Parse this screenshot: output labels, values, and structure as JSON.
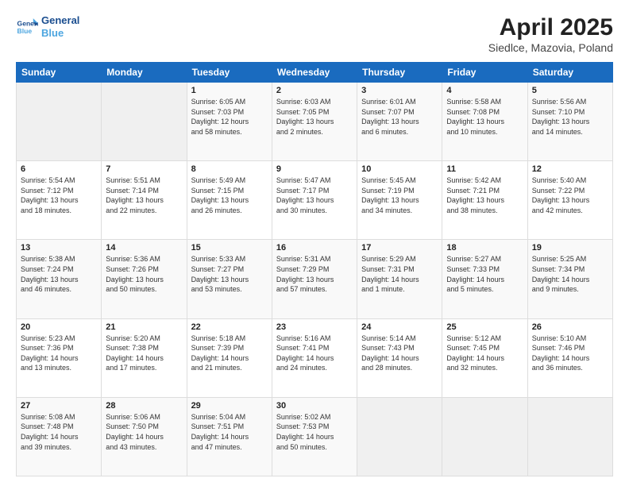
{
  "logo": {
    "line1": "General",
    "line2": "Blue"
  },
  "title": "April 2025",
  "subtitle": "Siedlce, Mazovia, Poland",
  "headers": [
    "Sunday",
    "Monday",
    "Tuesday",
    "Wednesday",
    "Thursday",
    "Friday",
    "Saturday"
  ],
  "weeks": [
    [
      {
        "num": "",
        "info": ""
      },
      {
        "num": "",
        "info": ""
      },
      {
        "num": "1",
        "info": "Sunrise: 6:05 AM\nSunset: 7:03 PM\nDaylight: 12 hours\nand 58 minutes."
      },
      {
        "num": "2",
        "info": "Sunrise: 6:03 AM\nSunset: 7:05 PM\nDaylight: 13 hours\nand 2 minutes."
      },
      {
        "num": "3",
        "info": "Sunrise: 6:01 AM\nSunset: 7:07 PM\nDaylight: 13 hours\nand 6 minutes."
      },
      {
        "num": "4",
        "info": "Sunrise: 5:58 AM\nSunset: 7:08 PM\nDaylight: 13 hours\nand 10 minutes."
      },
      {
        "num": "5",
        "info": "Sunrise: 5:56 AM\nSunset: 7:10 PM\nDaylight: 13 hours\nand 14 minutes."
      }
    ],
    [
      {
        "num": "6",
        "info": "Sunrise: 5:54 AM\nSunset: 7:12 PM\nDaylight: 13 hours\nand 18 minutes."
      },
      {
        "num": "7",
        "info": "Sunrise: 5:51 AM\nSunset: 7:14 PM\nDaylight: 13 hours\nand 22 minutes."
      },
      {
        "num": "8",
        "info": "Sunrise: 5:49 AM\nSunset: 7:15 PM\nDaylight: 13 hours\nand 26 minutes."
      },
      {
        "num": "9",
        "info": "Sunrise: 5:47 AM\nSunset: 7:17 PM\nDaylight: 13 hours\nand 30 minutes."
      },
      {
        "num": "10",
        "info": "Sunrise: 5:45 AM\nSunset: 7:19 PM\nDaylight: 13 hours\nand 34 minutes."
      },
      {
        "num": "11",
        "info": "Sunrise: 5:42 AM\nSunset: 7:21 PM\nDaylight: 13 hours\nand 38 minutes."
      },
      {
        "num": "12",
        "info": "Sunrise: 5:40 AM\nSunset: 7:22 PM\nDaylight: 13 hours\nand 42 minutes."
      }
    ],
    [
      {
        "num": "13",
        "info": "Sunrise: 5:38 AM\nSunset: 7:24 PM\nDaylight: 13 hours\nand 46 minutes."
      },
      {
        "num": "14",
        "info": "Sunrise: 5:36 AM\nSunset: 7:26 PM\nDaylight: 13 hours\nand 50 minutes."
      },
      {
        "num": "15",
        "info": "Sunrise: 5:33 AM\nSunset: 7:27 PM\nDaylight: 13 hours\nand 53 minutes."
      },
      {
        "num": "16",
        "info": "Sunrise: 5:31 AM\nSunset: 7:29 PM\nDaylight: 13 hours\nand 57 minutes."
      },
      {
        "num": "17",
        "info": "Sunrise: 5:29 AM\nSunset: 7:31 PM\nDaylight: 14 hours\nand 1 minute."
      },
      {
        "num": "18",
        "info": "Sunrise: 5:27 AM\nSunset: 7:33 PM\nDaylight: 14 hours\nand 5 minutes."
      },
      {
        "num": "19",
        "info": "Sunrise: 5:25 AM\nSunset: 7:34 PM\nDaylight: 14 hours\nand 9 minutes."
      }
    ],
    [
      {
        "num": "20",
        "info": "Sunrise: 5:23 AM\nSunset: 7:36 PM\nDaylight: 14 hours\nand 13 minutes."
      },
      {
        "num": "21",
        "info": "Sunrise: 5:20 AM\nSunset: 7:38 PM\nDaylight: 14 hours\nand 17 minutes."
      },
      {
        "num": "22",
        "info": "Sunrise: 5:18 AM\nSunset: 7:39 PM\nDaylight: 14 hours\nand 21 minutes."
      },
      {
        "num": "23",
        "info": "Sunrise: 5:16 AM\nSunset: 7:41 PM\nDaylight: 14 hours\nand 24 minutes."
      },
      {
        "num": "24",
        "info": "Sunrise: 5:14 AM\nSunset: 7:43 PM\nDaylight: 14 hours\nand 28 minutes."
      },
      {
        "num": "25",
        "info": "Sunrise: 5:12 AM\nSunset: 7:45 PM\nDaylight: 14 hours\nand 32 minutes."
      },
      {
        "num": "26",
        "info": "Sunrise: 5:10 AM\nSunset: 7:46 PM\nDaylight: 14 hours\nand 36 minutes."
      }
    ],
    [
      {
        "num": "27",
        "info": "Sunrise: 5:08 AM\nSunset: 7:48 PM\nDaylight: 14 hours\nand 39 minutes."
      },
      {
        "num": "28",
        "info": "Sunrise: 5:06 AM\nSunset: 7:50 PM\nDaylight: 14 hours\nand 43 minutes."
      },
      {
        "num": "29",
        "info": "Sunrise: 5:04 AM\nSunset: 7:51 PM\nDaylight: 14 hours\nand 47 minutes."
      },
      {
        "num": "30",
        "info": "Sunrise: 5:02 AM\nSunset: 7:53 PM\nDaylight: 14 hours\nand 50 minutes."
      },
      {
        "num": "",
        "info": ""
      },
      {
        "num": "",
        "info": ""
      },
      {
        "num": "",
        "info": ""
      }
    ]
  ]
}
